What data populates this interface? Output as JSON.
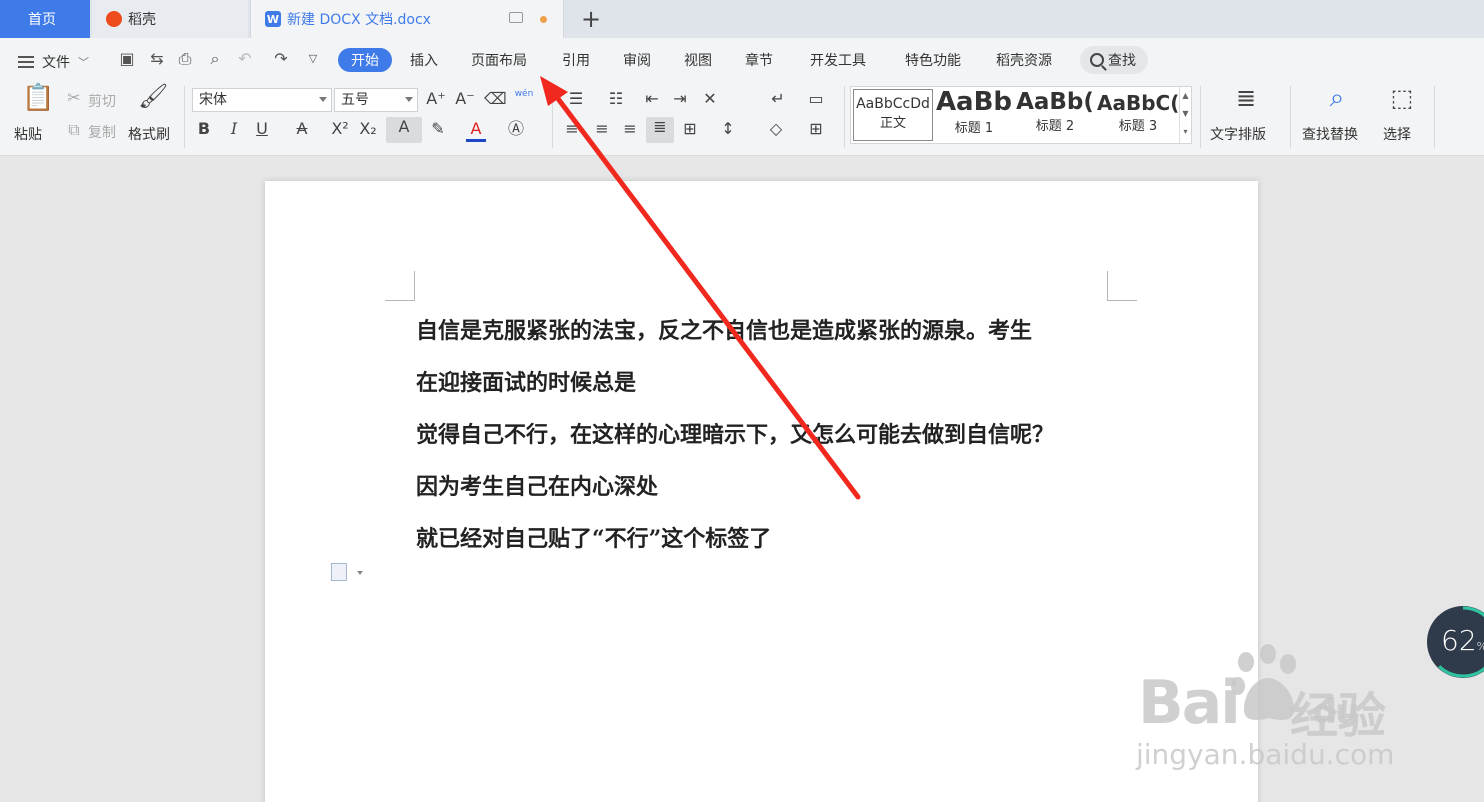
{
  "tabs": {
    "home": "首页",
    "daoke": "稻壳",
    "document": "新建 DOCX 文档.docx",
    "doc_logo": "W",
    "add": "+"
  },
  "menu": {
    "file": "文件",
    "items": [
      "开始",
      "插入",
      "页面布局",
      "引用",
      "审阅",
      "视图",
      "章节",
      "开发工具",
      "特色功能",
      "稻壳资源"
    ],
    "search": "查找"
  },
  "ribbon": {
    "paste": "粘贴",
    "cut": "剪切",
    "copy": "复制",
    "format_painter": "格式刷",
    "font_name": "宋体",
    "font_size": "五号",
    "pinyin_label": "wén",
    "styles": [
      {
        "sample": "AaBbCcDd",
        "name": "正文"
      },
      {
        "sample": "AaBb",
        "name": "标题 1"
      },
      {
        "sample": "AaBb(",
        "name": "标题 2"
      },
      {
        "sample": "AaBbC(",
        "name": "标题 3"
      }
    ],
    "text_layout": "文字排版",
    "find_replace": "查找替换",
    "select": "选择"
  },
  "document": {
    "lines": [
      "自信是克服紧张的法宝，反之不自信也是造成紧张的源泉。考生",
      "在迎接面试的时候总是",
      "觉得自己不行，在这样的心理暗示下，又怎么可能去做到自信呢？",
      "因为考生自己在内心深处",
      "就已经对自己贴了“不行”这个标签了"
    ]
  },
  "progress": {
    "value": "62",
    "unit": "%"
  },
  "watermark": {
    "brand": "Bai",
    "brand2": "du",
    "cn": "经验",
    "url": "jingyan.baidu.com"
  },
  "colors": {
    "accent": "#3f7be8",
    "annotation_arrow": "#f0281e"
  }
}
